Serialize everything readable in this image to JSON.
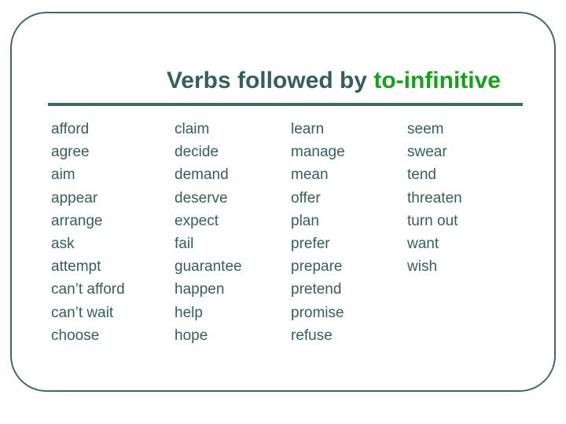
{
  "slide": {
    "title": {
      "main_text": "Verbs followed by ",
      "accent_text": "to-infinitive",
      "main_color": "#33605f",
      "accent_color": "#17a01c"
    },
    "frame_color": "#3d6b6a",
    "rule_color": "#3d6b6a",
    "background_color": "#ffffff",
    "body_text_color": "#33605f",
    "columns": [
      {
        "index": 1,
        "verbs": [
          "afford",
          "agree",
          "aim",
          "appear",
          "arrange",
          "ask",
          "attempt",
          "can’t afford",
          "can’t wait",
          "choose"
        ]
      },
      {
        "index": 2,
        "verbs": [
          "claim",
          "decide",
          "demand",
          "deserve",
          "expect",
          "fail",
          "guarantee",
          "happen",
          "help",
          "hope"
        ]
      },
      {
        "index": 3,
        "verbs": [
          "learn",
          "manage",
          "mean",
          "offer",
          "plan",
          "prefer",
          "prepare",
          "pretend",
          "promise",
          "refuse"
        ]
      },
      {
        "index": 4,
        "verbs": [
          "seem",
          "swear",
          "tend",
          "threaten",
          "turn out",
          "want",
          "wish"
        ]
      }
    ]
  }
}
